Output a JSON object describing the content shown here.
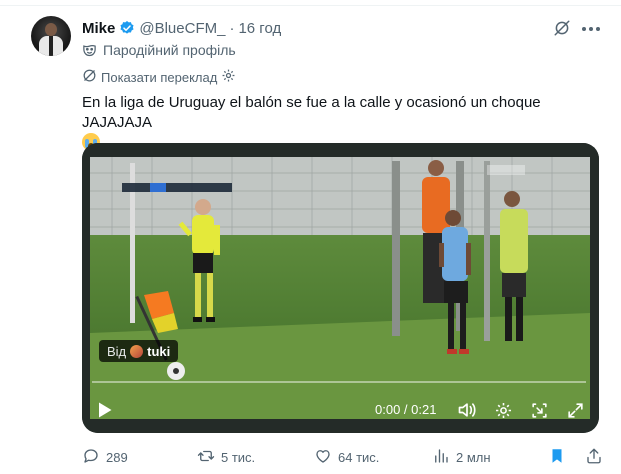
{
  "tweet": {
    "author_name": "Mike",
    "handle": "@BlueCFM_",
    "separator": "·",
    "time": "16 год",
    "parody_label": "Пародійний профіль",
    "translate_label": "Показати переклад",
    "text": "En la liga de Uruguay el balón se fue a la calle y ocasionó un choque JAJAJAJA"
  },
  "media": {
    "source_prefix": "Від",
    "source_name": "tuki",
    "timecode": "0:00 / 0:21",
    "progress": 0.0
  },
  "actions": {
    "replies": "289",
    "reposts": "5 тис.",
    "likes": "64 тис.",
    "views": "2 млн"
  },
  "colors": {
    "accent": "#1d9bf0",
    "muted": "#536471",
    "bookmark_active": "#1d9bf0",
    "verified": "#1d9bf0"
  },
  "icons": {
    "verified": "verified-badge-icon",
    "grok": "grok-icon",
    "more": "more-icon",
    "parody": "mask-icon",
    "translate": "translate-icon",
    "settings": "gear-icon",
    "play": "play-icon",
    "volume": "volume-icon",
    "dock": "dock-icon",
    "fullscreen": "fullscreen-icon",
    "reply": "reply-icon",
    "repost": "repost-icon",
    "like": "heart-icon",
    "views": "views-icon",
    "bookmark": "bookmark-icon",
    "share": "share-icon"
  }
}
